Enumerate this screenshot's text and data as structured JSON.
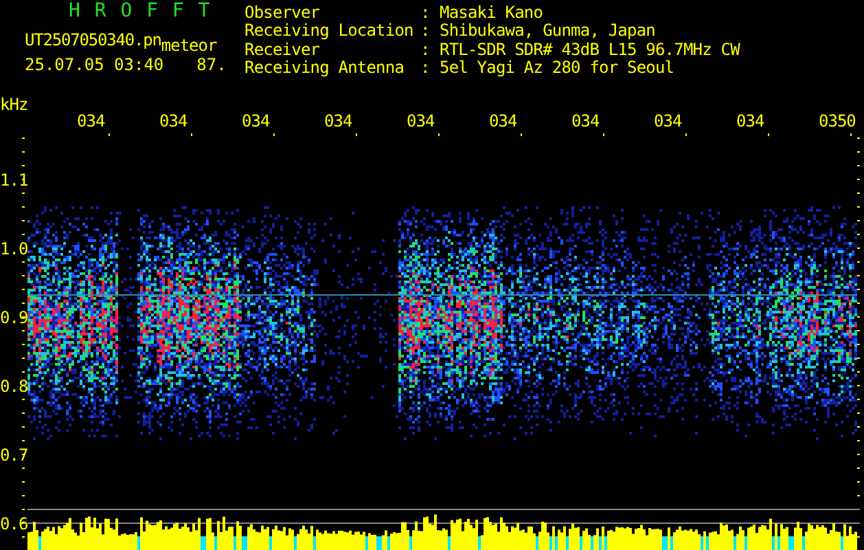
{
  "app_title": "H R O F F T",
  "file": {
    "name": "UT2507050340.pn",
    "suffix": "meteor",
    "timestamp": "25.07.05 03:40",
    "value": "87."
  },
  "info": [
    {
      "label": "Observer",
      "separator": ":",
      "value": "Masaki Kano"
    },
    {
      "label": "Receiving Location",
      "separator": ":",
      "value": "Shibukawa, Gunma, Japan"
    },
    {
      "label": "Receiver",
      "separator": ":",
      "value": "RTL-SDR SDR# 43dB L15 96.7MHz CW"
    },
    {
      "label": "Receiving Antenna",
      "separator": ":",
      "value": "5el Yagi Az 280 for Seoul"
    }
  ],
  "chart": {
    "unit": "kHz",
    "time_labels": [
      "034",
      "034",
      "034",
      "034",
      "034",
      "034",
      "034",
      "034",
      "034",
      "0350"
    ],
    "frequency_labels": [
      "1.1",
      "1.0",
      "0.9",
      "0.8",
      "0.7",
      "0.6"
    ]
  }
}
